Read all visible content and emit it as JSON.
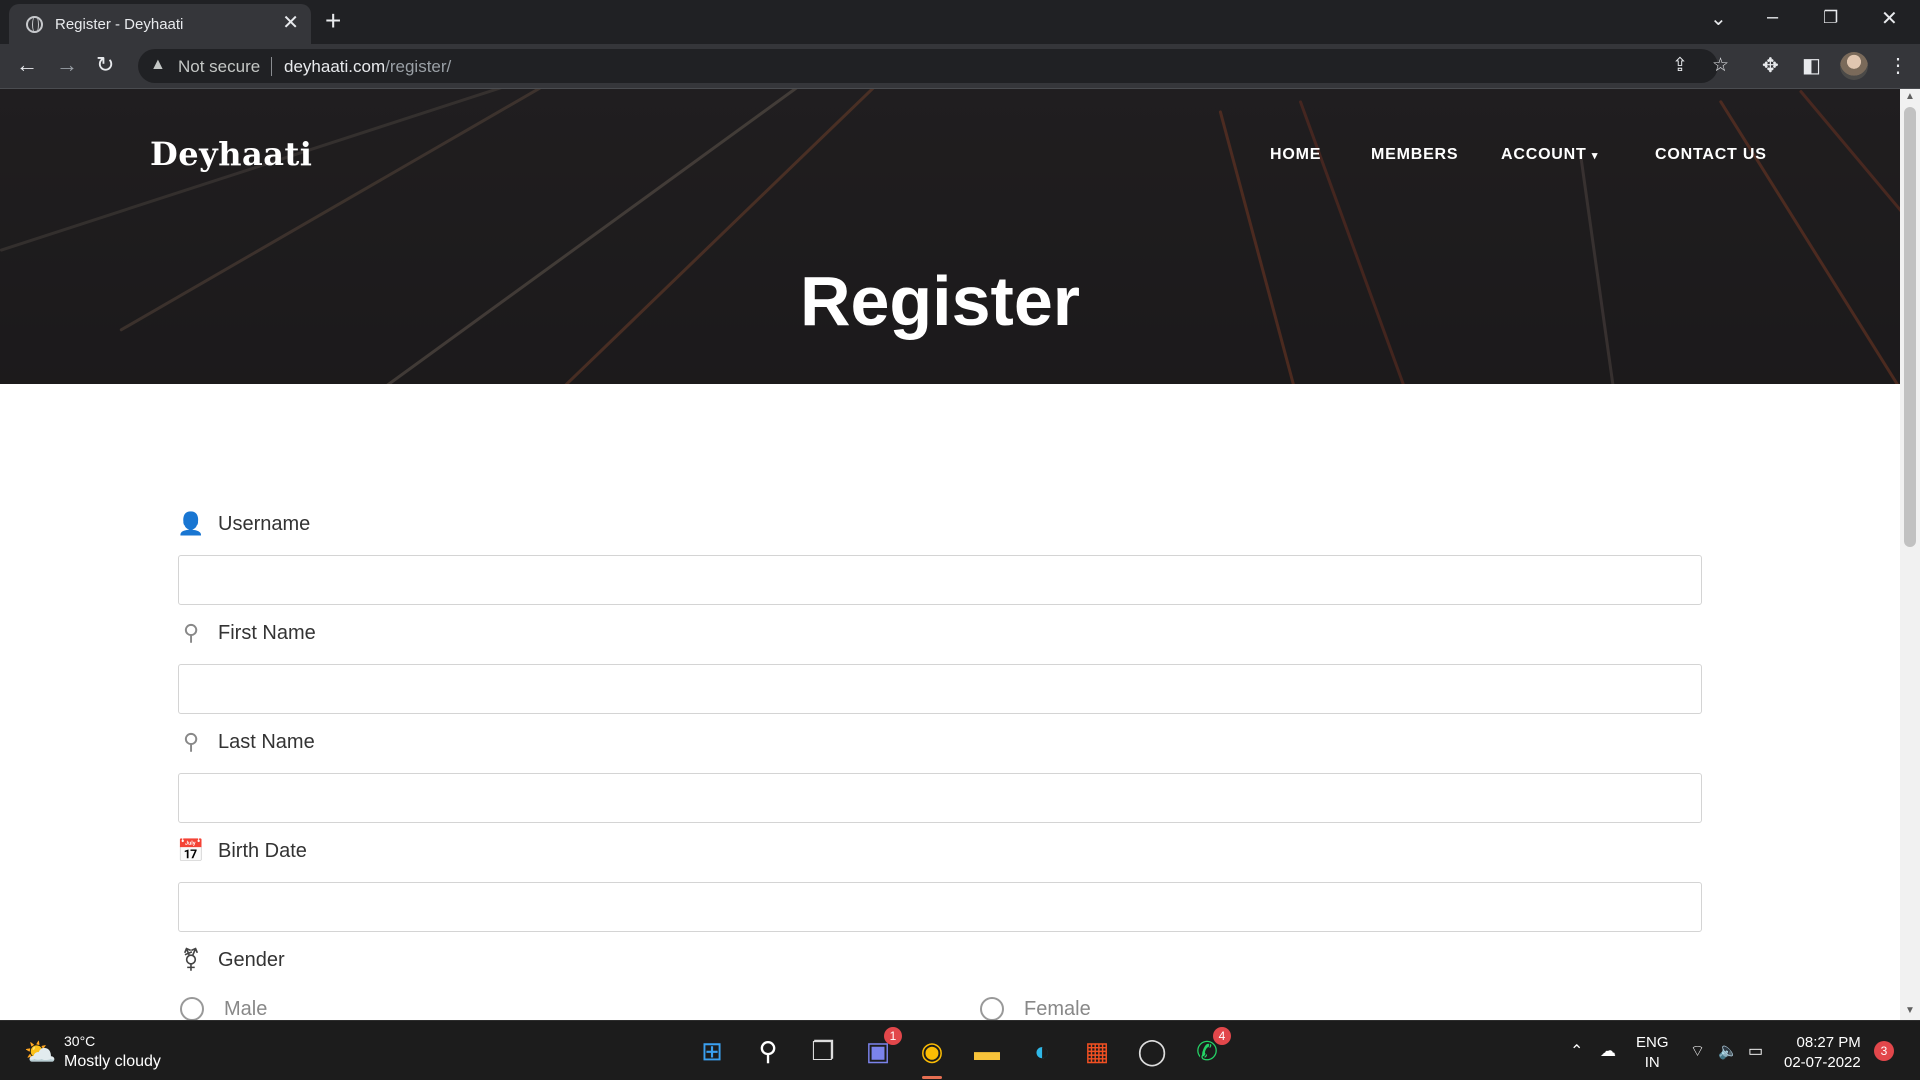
{
  "browser": {
    "tab_title": "Register - Deyhaati",
    "security_label": "Not secure",
    "url_host": "deyhaati.com",
    "url_path": "/register/"
  },
  "site": {
    "brand": "Deyhaati",
    "nav": {
      "home": "HOME",
      "members": "MEMBERS",
      "account": "ACCOUNT",
      "contact": "CONTACT US"
    },
    "page_title": "Register"
  },
  "form": {
    "username_label": "Username",
    "first_name_label": "First Name",
    "last_name_label": "Last Name",
    "birth_date_label": "Birth Date",
    "gender_label": "Gender",
    "gender_options": [
      "Male",
      "Female"
    ]
  },
  "taskbar": {
    "temperature": "30°C",
    "weather": "Mostly cloudy",
    "teams_badge": "1",
    "whatsapp_badge": "4",
    "lang_line1": "ENG",
    "lang_line2": "IN",
    "time": "08:27 PM",
    "date": "02-07-2022",
    "notifications": "3"
  },
  "colors": {
    "browser_frame": "#202124",
    "toolbar": "#35363a",
    "hero_overlay": "#231f20",
    "streak_orange": "#c0532e",
    "input_border": "#d4d4d4"
  }
}
